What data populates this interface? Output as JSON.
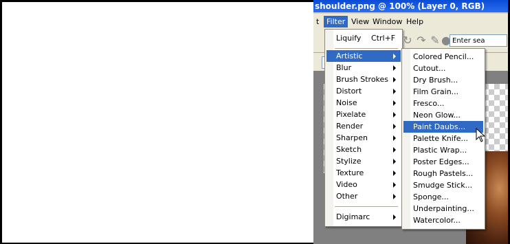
{
  "window": {
    "title": "shoulder.png @ 100% (Layer 0, RGB)"
  },
  "menubar": {
    "items": [
      {
        "label": "t"
      },
      {
        "label": "Filter"
      },
      {
        "label": "View"
      },
      {
        "label": "Window"
      },
      {
        "label": "Help"
      }
    ],
    "active_index": 1
  },
  "toolbar": {
    "search_value": "Enter sea"
  },
  "filter_menu": {
    "last_filter": {
      "label": "Liquify",
      "shortcut": "Ctrl+F"
    },
    "items": [
      {
        "label": "Artistic",
        "has_submenu": true,
        "highlighted": true
      },
      {
        "label": "Blur",
        "has_submenu": true
      },
      {
        "label": "Brush Strokes",
        "has_submenu": true
      },
      {
        "label": "Distort",
        "has_submenu": true
      },
      {
        "label": "Noise",
        "has_submenu": true
      },
      {
        "label": "Pixelate",
        "has_submenu": true
      },
      {
        "label": "Render",
        "has_submenu": true
      },
      {
        "label": "Sharpen",
        "has_submenu": true
      },
      {
        "label": "Sketch",
        "has_submenu": true
      },
      {
        "label": "Stylize",
        "has_submenu": true
      },
      {
        "label": "Texture",
        "has_submenu": true
      },
      {
        "label": "Video",
        "has_submenu": true
      },
      {
        "label": "Other",
        "has_submenu": true
      }
    ],
    "extra": {
      "label": "Digimarc",
      "has_submenu": true
    }
  },
  "artistic_submenu": {
    "items": [
      {
        "label": "Colored Pencil..."
      },
      {
        "label": "Cutout..."
      },
      {
        "label": "Dry Brush..."
      },
      {
        "label": "Film Grain..."
      },
      {
        "label": "Fresco..."
      },
      {
        "label": "Neon Glow..."
      },
      {
        "label": "Paint Daubs...",
        "highlighted": true
      },
      {
        "label": "Palette Knife..."
      },
      {
        "label": "Plastic Wrap..."
      },
      {
        "label": "Poster Edges..."
      },
      {
        "label": "Rough Pastels..."
      },
      {
        "label": "Smudge Stick..."
      },
      {
        "label": "Sponge..."
      },
      {
        "label": "Underpainting..."
      },
      {
        "label": "Watercolor..."
      }
    ]
  },
  "colors": {
    "highlight": "#316ac5",
    "titlebar": "#0a4bd6"
  }
}
